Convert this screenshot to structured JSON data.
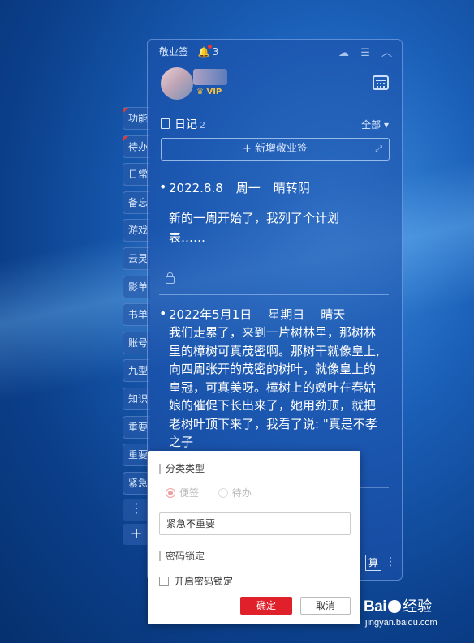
{
  "app": {
    "title": "敬业签",
    "notif_count": "3",
    "vip": "VIP"
  },
  "side_tabs": [
    "功能",
    "待办",
    "日常",
    "备忘",
    "游戏",
    "云灵",
    "影单",
    "书单",
    "账号",
    "九型",
    "知识",
    "重要",
    "重要",
    "紧急"
  ],
  "side_tabs_red": [
    0,
    1
  ],
  "side_more": "⋮",
  "side_add": "+",
  "category": {
    "title": "日记",
    "count": "2",
    "filter": "全部 ▾"
  },
  "add_button": "+ 新增敬业签",
  "notes": [
    {
      "date": "2022.8.8",
      "weekday": "周一",
      "weather": "晴转阴",
      "body": "新的一周开始了，我列了个计划表……"
    },
    {
      "date": "2022年5月1日",
      "weekday": "星期日",
      "weather": "晴天",
      "body": "我们走累了，来到一片树林里，那树林里的樟树可真茂密啊。那树干就像皇上,向四周张开的茂密的树叶，就像皇上的皇冠，可真美呀。樟树上的嫩叶在春姑娘的催促下长出来了，她用劲顶，就把老树叶顶下来了，我看了说: \"真是不孝之子"
    }
  ],
  "bottom": {
    "calc_label": "算"
  },
  "popup": {
    "section_type": "分类类型",
    "radio_note": "便签",
    "radio_todo": "待办",
    "selected_category": "紧急不重要",
    "section_lock": "密码锁定",
    "lock_checkbox": "开启密码锁定",
    "ok": "确定",
    "cancel": "取消"
  },
  "watermark": {
    "logo_a": "Bai",
    "logo_b": "经验",
    "url": "jingyan.baidu.com"
  },
  "colors": {
    "accent": "#e0202a",
    "panel": "#1e50aa",
    "vip": "#f6c343"
  }
}
